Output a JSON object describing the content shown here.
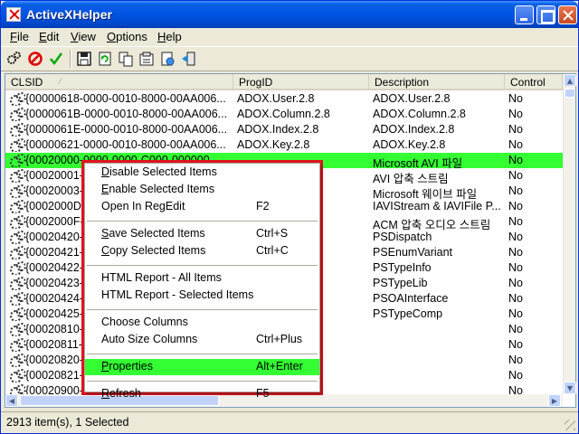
{
  "window": {
    "title": "ActiveXHelper"
  },
  "menubar": [
    "File",
    "Edit",
    "View",
    "Options",
    "Help"
  ],
  "toolbar": [
    "chip-icon",
    "stop-icon",
    "check-icon",
    "save-icon",
    "refresh-icon",
    "copy-icon",
    "properties-icon",
    "html-report-icon",
    "exit-icon"
  ],
  "columns": [
    "CLSID",
    "ProgID",
    "Description",
    "Control"
  ],
  "rows": [
    {
      "clsid": "{00000618-0000-0010-8000-00AA006...",
      "progid": "ADOX.User.2.8",
      "desc": "ADOX.User.2.8",
      "control": "No"
    },
    {
      "clsid": "{0000061B-0000-0010-8000-00AA006...",
      "progid": "ADOX.Column.2.8",
      "desc": "ADOX.Column.2.8",
      "control": "No"
    },
    {
      "clsid": "{0000061E-0000-0010-8000-00AA006...",
      "progid": "ADOX.Index.2.8",
      "desc": "ADOX.Index.2.8",
      "control": "No"
    },
    {
      "clsid": "{00000621-0000-0010-8000-00AA006...",
      "progid": "ADOX.Key.2.8",
      "desc": "ADOX.Key.2.8",
      "control": "No"
    },
    {
      "clsid": "{00020000-0000-0000-C000-000000...",
      "progid": "",
      "desc": "Microsoft AVI 파일",
      "control": "No",
      "selected": true
    },
    {
      "clsid": "{00020001-",
      "progid": "",
      "desc": "AVI 압축 스트림",
      "control": "No"
    },
    {
      "clsid": "{00020003-",
      "progid": "",
      "desc": "Microsoft 웨이브 파일",
      "control": "No"
    },
    {
      "clsid": "{0002000D-",
      "progid": "",
      "desc": "IAVIStream & IAVIFile P...",
      "control": "No"
    },
    {
      "clsid": "{0002000F-",
      "progid": "",
      "desc": "ACM 압축 오디오 스트림",
      "control": "No"
    },
    {
      "clsid": "{00020420-",
      "progid": "",
      "desc": "PSDispatch",
      "control": "No"
    },
    {
      "clsid": "{00020421-",
      "progid": "",
      "desc": "PSEnumVariant",
      "control": "No"
    },
    {
      "clsid": "{00020422-",
      "progid": "",
      "desc": "PSTypeInfo",
      "control": "No"
    },
    {
      "clsid": "{00020423-",
      "progid": "",
      "desc": "PSTypeLib",
      "control": "No"
    },
    {
      "clsid": "{00020424-",
      "progid": "",
      "desc": "PSOAInterface",
      "control": "No"
    },
    {
      "clsid": "{00020425-",
      "progid": "",
      "desc": "PSTypeComp",
      "control": "No"
    },
    {
      "clsid": "{00020810-",
      "progid": "",
      "desc": "",
      "control": "No"
    },
    {
      "clsid": "{00020811-",
      "progid": "",
      "desc": "",
      "control": "No"
    },
    {
      "clsid": "{00020820-",
      "progid": "",
      "desc": "",
      "control": "No"
    },
    {
      "clsid": "{00020821-",
      "progid": "",
      "desc": "",
      "control": "No"
    },
    {
      "clsid": "{00020900-",
      "progid": "",
      "desc": "",
      "control": "No"
    }
  ],
  "context_menu": [
    {
      "label": "Disable Selected Items",
      "shortcut": ""
    },
    {
      "label": "Enable Selected Items",
      "shortcut": ""
    },
    {
      "label": "Open In RegEdit",
      "shortcut": "F2"
    },
    {
      "sep": true
    },
    {
      "label": "Save Selected Items",
      "shortcut": "Ctrl+S"
    },
    {
      "label": "Copy Selected Items",
      "shortcut": "Ctrl+C"
    },
    {
      "sep": true
    },
    {
      "label": "HTML Report - All Items",
      "shortcut": ""
    },
    {
      "label": "HTML Report - Selected Items",
      "shortcut": ""
    },
    {
      "sep": true
    },
    {
      "label": "Choose Columns",
      "shortcut": ""
    },
    {
      "label": "Auto Size Columns",
      "shortcut": "Ctrl+Plus"
    },
    {
      "sep": true
    },
    {
      "label": "Properties",
      "shortcut": "Alt+Enter",
      "highlighted": true
    },
    {
      "sep": true
    },
    {
      "label": "Refresh",
      "shortcut": "F5"
    }
  ],
  "status": {
    "text": "2913 item(s), 1 Selected"
  },
  "colors": {
    "selection": "#33ff33",
    "menu_outline": "#e0141e",
    "titlebar": "#0054e3"
  }
}
